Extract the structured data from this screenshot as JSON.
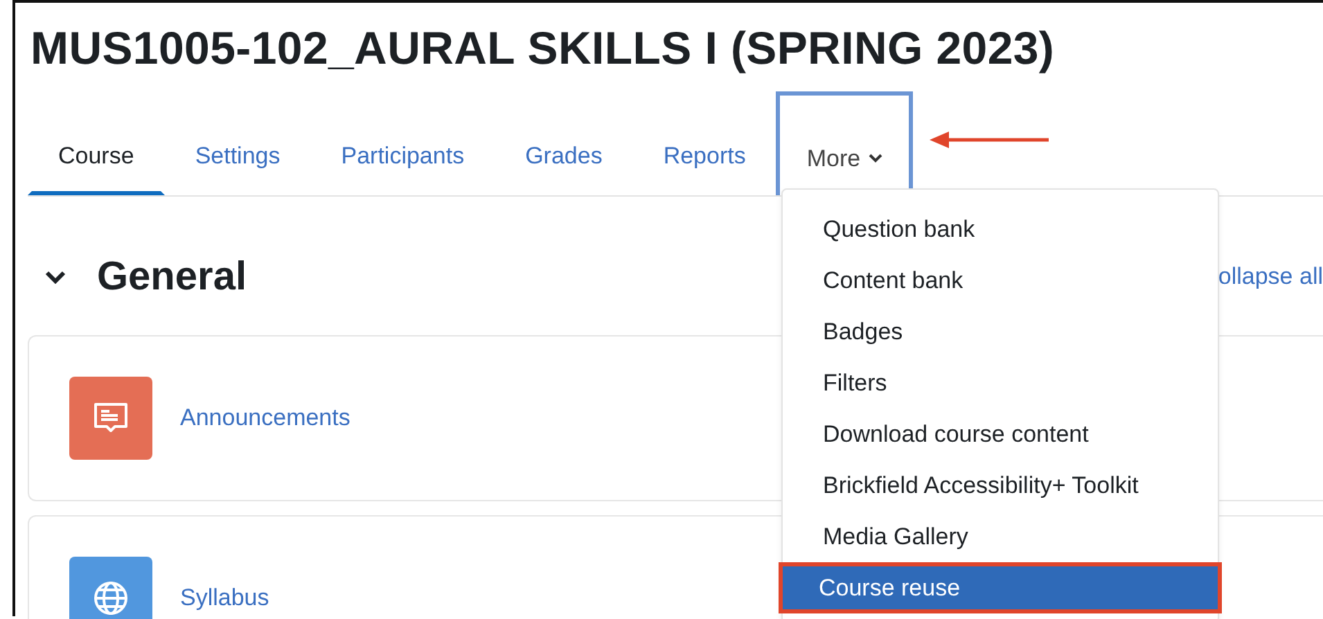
{
  "title": "MUS1005-102_AURAL SKILLS I (SPRING 2023)",
  "tabs": [
    {
      "label": "Course",
      "selected": true,
      "outlined": false,
      "dropdown": false
    },
    {
      "label": "Settings",
      "selected": false,
      "outlined": false,
      "dropdown": false
    },
    {
      "label": "Participants",
      "selected": false,
      "outlined": false,
      "dropdown": false
    },
    {
      "label": "Grades",
      "selected": false,
      "outlined": false,
      "dropdown": false
    },
    {
      "label": "Reports",
      "selected": false,
      "outlined": false,
      "dropdown": false
    },
    {
      "label": "More",
      "selected": false,
      "outlined": true,
      "dropdown": true
    }
  ],
  "section": {
    "title": "General",
    "expanded": true,
    "collapse_link": "ollapse all"
  },
  "activities": [
    {
      "kind": "forum",
      "label": "Announcements"
    },
    {
      "kind": "url",
      "label": "Syllabus"
    }
  ],
  "menu": [
    {
      "label": "Question bank",
      "selected": false,
      "outlined": false
    },
    {
      "label": "Content bank",
      "selected": false,
      "outlined": false
    },
    {
      "label": "Badges",
      "selected": false,
      "outlined": false
    },
    {
      "label": "Filters",
      "selected": false,
      "outlined": false
    },
    {
      "label": "Download course content",
      "selected": false,
      "outlined": false
    },
    {
      "label": "Brickfield Accessibility+ Toolkit",
      "selected": false,
      "outlined": false
    },
    {
      "label": "Media Gallery",
      "selected": false,
      "outlined": false
    },
    {
      "label": "Course reuse",
      "selected": true,
      "outlined": true
    }
  ]
}
